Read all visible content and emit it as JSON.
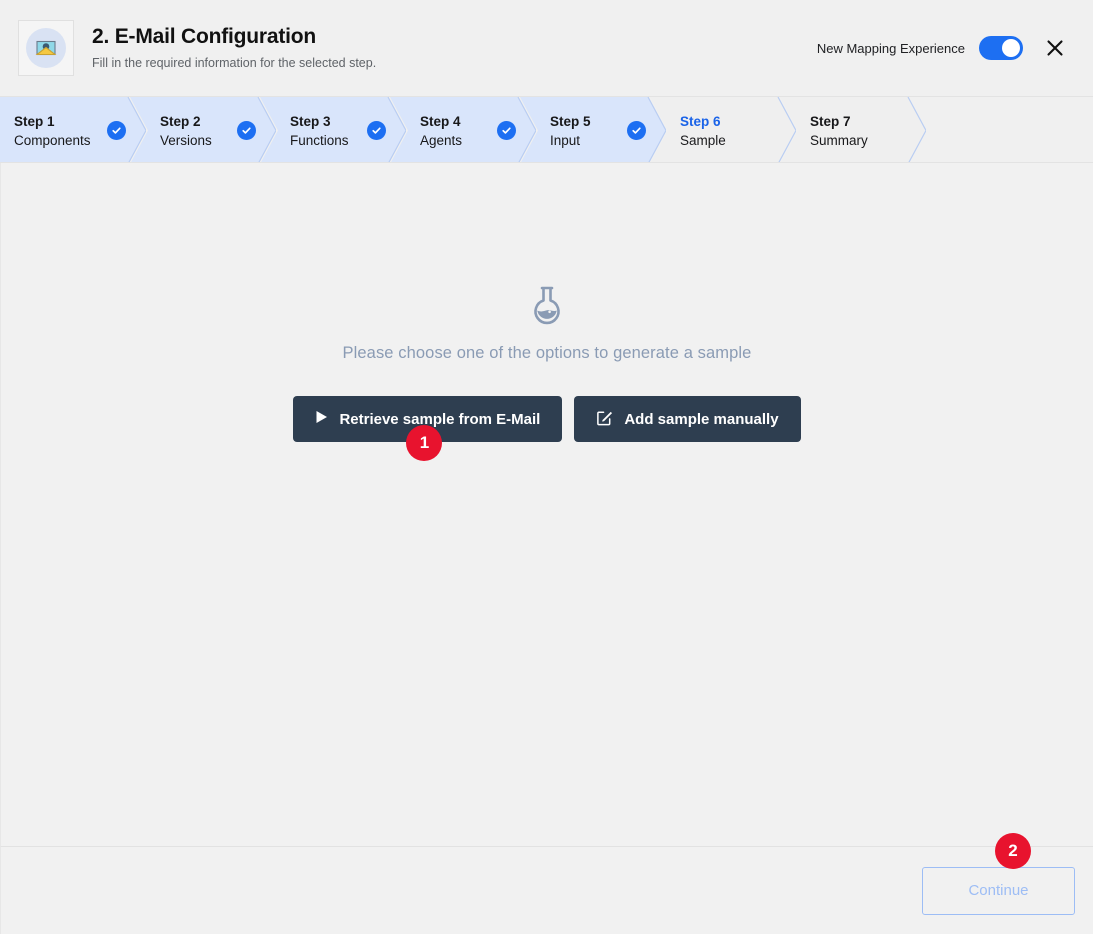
{
  "header": {
    "icon": "email-envelope-icon",
    "title": "2. E-Mail Configuration",
    "subtitle": "Fill in the required information for the selected step.",
    "toggle_label": "New Mapping Experience",
    "toggle_on": true,
    "close_icon": "close-icon"
  },
  "steps": [
    {
      "num": "Step 1",
      "name": "Components",
      "state": "done"
    },
    {
      "num": "Step 2",
      "name": "Versions",
      "state": "done"
    },
    {
      "num": "Step 3",
      "name": "Functions",
      "state": "done"
    },
    {
      "num": "Step 4",
      "name": "Agents",
      "state": "done"
    },
    {
      "num": "Step 5",
      "name": "Input",
      "state": "done"
    },
    {
      "num": "Step 6",
      "name": "Sample",
      "state": "active"
    },
    {
      "num": "Step 7",
      "name": "Summary",
      "state": "todo"
    }
  ],
  "main": {
    "flask_icon": "flask-icon",
    "empty_message": "Please choose one of the options to generate a sample",
    "buttons": [
      {
        "label": "Retrieve sample from E-Mail",
        "icon": "play-icon"
      },
      {
        "label": "Add sample manually",
        "icon": "edit-pencil-icon"
      }
    ]
  },
  "annotations": [
    {
      "number": "1"
    },
    {
      "number": "2"
    }
  ],
  "footer": {
    "continue_label": "Continue"
  },
  "colors": {
    "accent_blue": "#1d6ff2",
    "step_done_bg": "#d9e5fb",
    "button_dark": "#2e3e50",
    "badge_red": "#e8132e",
    "muted_text": "#8a9bb4",
    "page_bg": "#f1f1f1"
  }
}
